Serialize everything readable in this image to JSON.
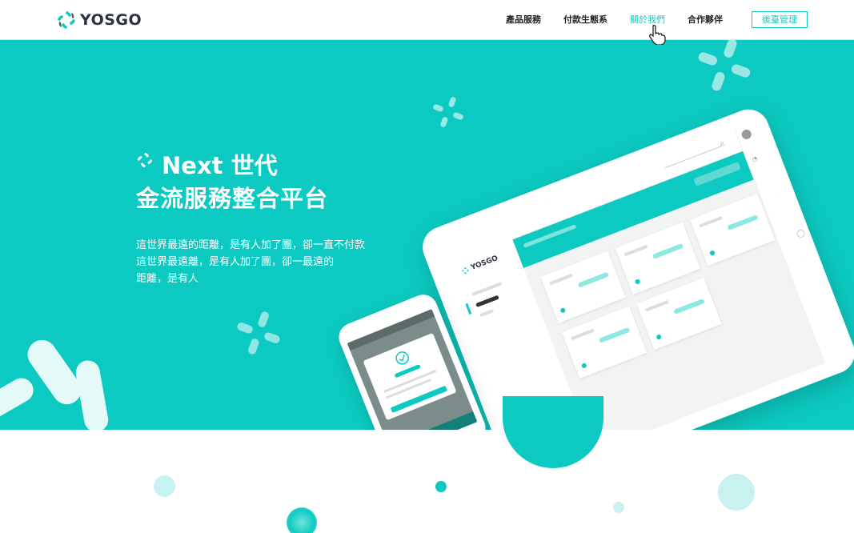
{
  "header": {
    "logo_text": "YOSGO",
    "nav": [
      {
        "label": "產品服務",
        "active": false
      },
      {
        "label": "付款生態系",
        "active": false
      },
      {
        "label": "關於我們",
        "active": true
      },
      {
        "label": "合作夥伴",
        "active": false
      }
    ],
    "admin_button": "後臺管理"
  },
  "hero": {
    "title_line1": "Next 世代",
    "title_line2": "金流服務整合平台",
    "desc_line1": "這世界最遠的距離，是有人加了團，卻一直不付款",
    "desc_line2": "這世界最遠離，是有人加了團，卻一最遠的",
    "desc_line3": "距離，是有人"
  },
  "tablet": {
    "logo_text": "YOSGO"
  },
  "colors": {
    "accent": "#0ccac1",
    "accent_dark": "#1cc7bd",
    "light_accent": "#c8f2f0",
    "text_dark": "#222222"
  },
  "icons": [
    "yosgo-logo-icon",
    "pointer-cursor-icon",
    "search-icon",
    "bell-icon",
    "checkmark-icon"
  ]
}
